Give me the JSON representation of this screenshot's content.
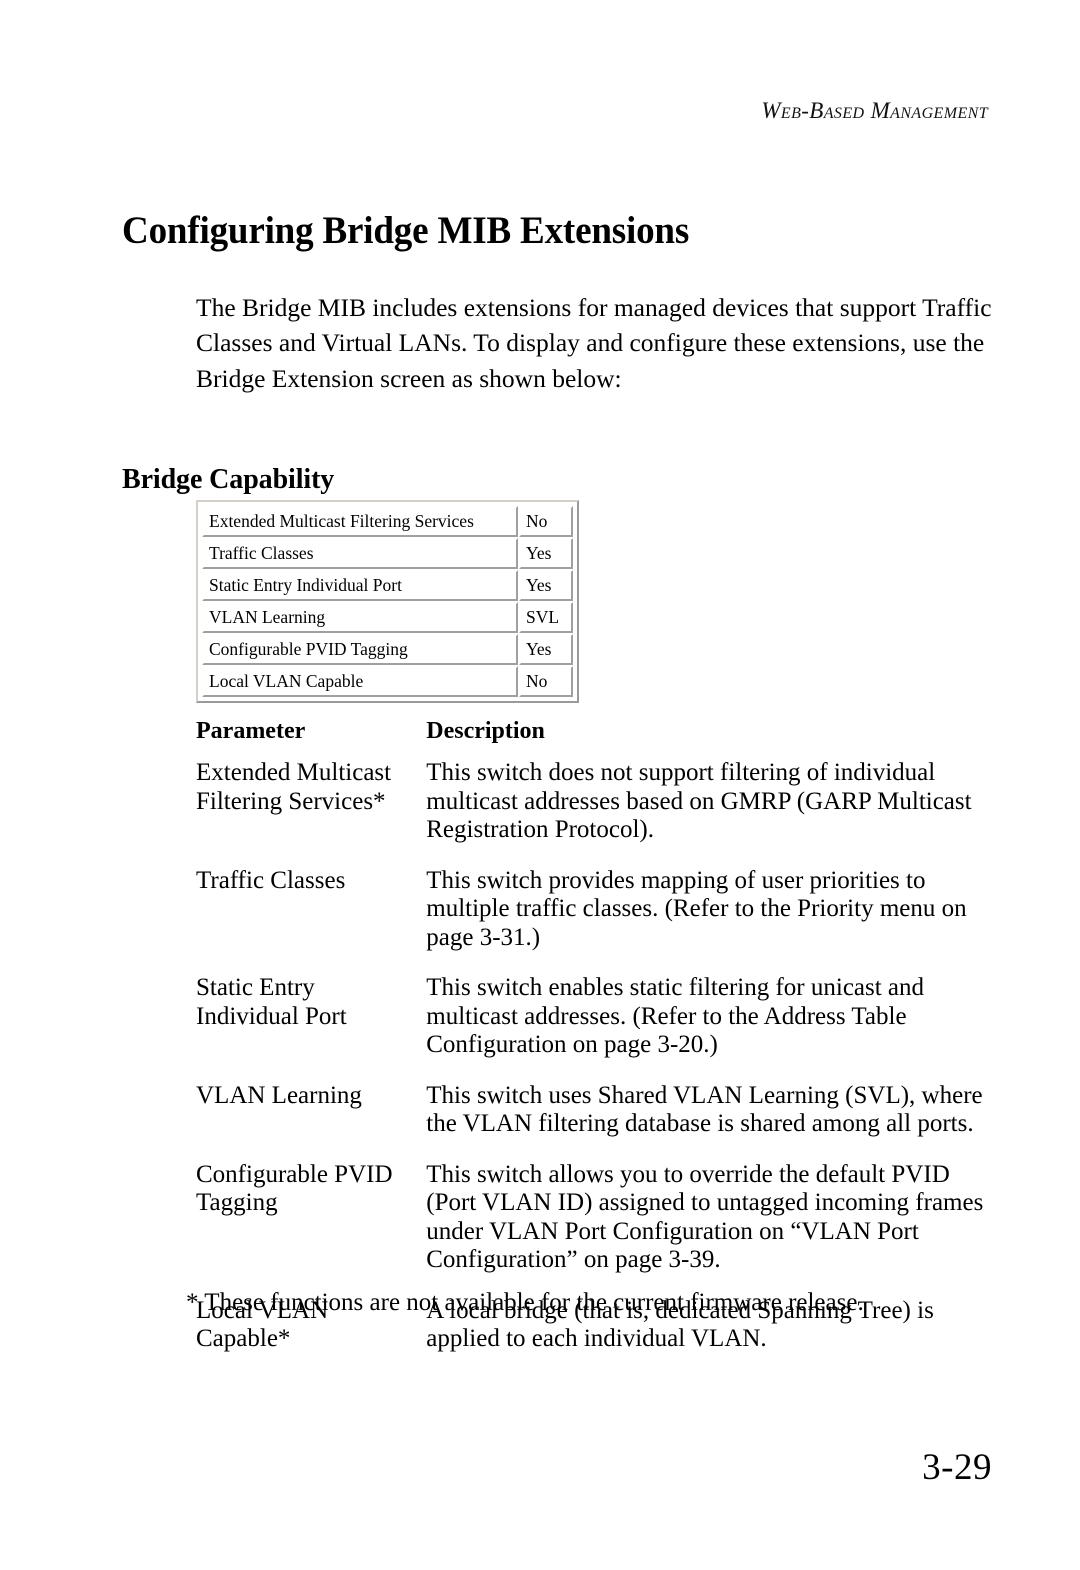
{
  "page": {
    "running_header": "Web-Based Management",
    "folio": "3-29"
  },
  "chapter": {
    "title": "Configuring Bridge MIB Extensions",
    "intro": "The Bridge MIB includes extensions for managed devices that support Traffic Classes and Virtual LANs. To display and configure these extensions, use the Bridge Extension screen as shown below:"
  },
  "section": {
    "heading": "Bridge Capability"
  },
  "capability_screenshot": {
    "rows": [
      {
        "name": "Extended Multicast Filtering Services",
        "value": "No"
      },
      {
        "name": "Traffic Classes",
        "value": "Yes"
      },
      {
        "name": "Static Entry Individual Port",
        "value": "Yes"
      },
      {
        "name": "VLAN Learning",
        "value": "SVL"
      },
      {
        "name": "Configurable PVID Tagging",
        "value": "Yes"
      },
      {
        "name": "Local VLAN Capable",
        "value": "No"
      }
    ]
  },
  "parameter_table": {
    "headers": {
      "parameter": "Parameter",
      "description": "Description"
    },
    "rows": [
      {
        "parameter": "Extended Multicast Filtering Services*",
        "description": "This switch does not support filtering of individual multicast addresses based on GMRP (GARP Multicast Registration Protocol)."
      },
      {
        "parameter": "Traffic Classes",
        "description": "This switch provides mapping of user priorities to multiple traffic classes. (Refer to the Priority menu on page 3-31.)"
      },
      {
        "parameter": "Static Entry Individual Port",
        "description": "This switch enables static filtering for unicast and multicast addresses. (Refer to the Address Table Configuration on page 3-20.)"
      },
      {
        "parameter": "VLAN Learning",
        "description": "This switch uses Shared VLAN Learning (SVL), where the VLAN filtering database is shared among all ports."
      },
      {
        "parameter": "Configurable PVID Tagging",
        "description": "This switch allows you to override the default PVID (Port VLAN ID) assigned to untagged incoming frames under VLAN Port Configuration on “VLAN Port Configuration” on page 3-39."
      },
      {
        "parameter": "Local VLAN Capable*",
        "description": "A local bridge (that is, dedicated Spanning Tree) is applied to each individual VLAN."
      }
    ],
    "footnote": "* These functions are not available for the current firmware release."
  }
}
